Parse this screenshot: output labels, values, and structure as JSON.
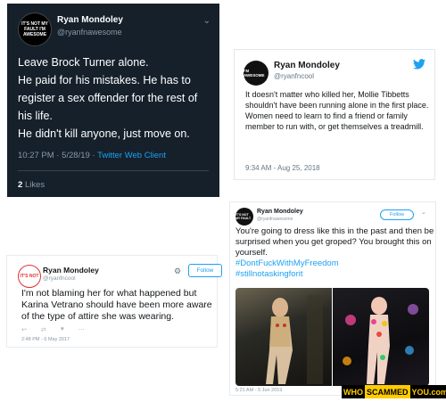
{
  "tweet1": {
    "avatar_text": "IT'S NOT MY FAULT I'M AWESOME",
    "name": "Ryan Mondoley",
    "handle": "@ryanfnawesome",
    "lines": [
      "Leave Brock Turner alone.",
      "He paid for his mistakes. He has to register a sex offender for the rest of his life.",
      "He didn't kill anyone, just move on."
    ],
    "time": "10:27 PM · 5/28/19 ·",
    "source": "Twitter Web Client",
    "likes_count": "2",
    "likes_label": "Likes"
  },
  "tweet2": {
    "avatar_text": "I'M AWESOME",
    "name": "Ryan Mondoley",
    "handle": "@ryanfncool",
    "lines": [
      "It doesn't matter who killed her, Mollie Tibbetts shouldn't have been running alone in the first place.",
      "Women need to learn to find a friend or family member to run with, or get themselves a treadmill."
    ],
    "time": "9:34 AM - Aug 25, 2018"
  },
  "tweet3": {
    "avatar_text": "IT'S NOT",
    "name": "Ryan Mondoley",
    "handle": "@ryanfncool",
    "follow_label": "Follow",
    "body": "I'm not blaming her for what happened but Karina Vetrano should have been more aware of the type of attire she was wearing.",
    "actions": [
      "↩",
      "⇄",
      "♥",
      "⋯"
    ],
    "time": "2:48 PM - 6 May 2017"
  },
  "tweet4": {
    "avatar_text": "IT'S NOT MY FAULT",
    "name": "Ryan Mondoley",
    "handle": "@ryanfnawesome",
    "follow_label": "Follow",
    "body": "You're going to dress like this in the past and then be surprised when you get groped? You brought this on yourself.",
    "hashtag1": "#DontFuckWithMyFreedom",
    "hashtag2": "#stillnotaskingforit",
    "time": "5:21 AM - 5 Jun 2019"
  },
  "watermark": {
    "part1": "WHO",
    "part2": "SCAMMED",
    "part3": "YOU.com"
  }
}
